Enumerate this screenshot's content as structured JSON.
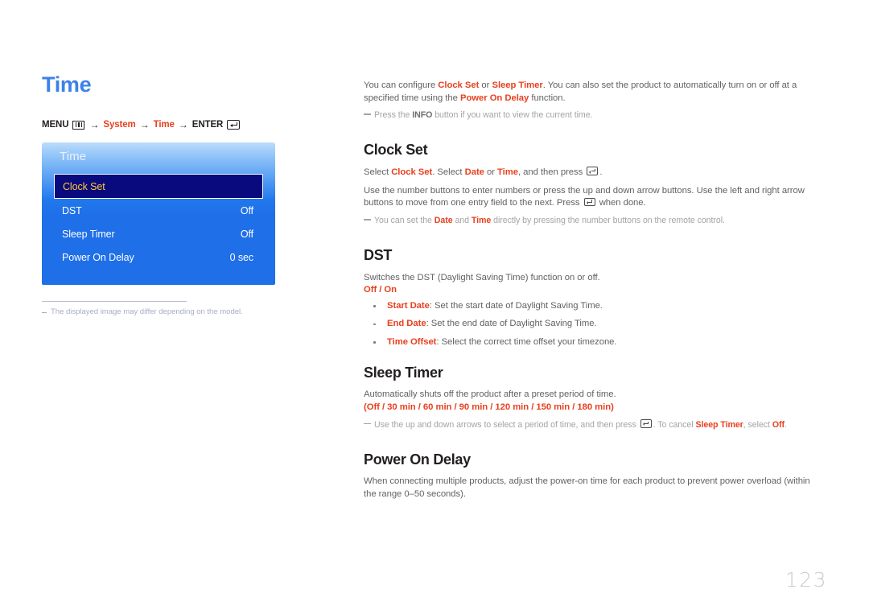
{
  "page": {
    "title": "Time",
    "number": "123"
  },
  "breadcrumb": {
    "menu_label": "MENU",
    "menu_icon": "menu-grid-icon",
    "arrow": "→",
    "item1": "System",
    "item2": "Time",
    "enter_label": "ENTER",
    "enter_icon": "enter-key-icon"
  },
  "osd": {
    "title": "Time",
    "rows": [
      {
        "label": "Clock Set",
        "value": "",
        "selected": true
      },
      {
        "label": "DST",
        "value": "Off",
        "selected": false
      },
      {
        "label": "Sleep Timer",
        "value": "Off",
        "selected": false
      },
      {
        "label": "Power On Delay",
        "value": "0 sec",
        "selected": false
      }
    ]
  },
  "image_note": "The displayed image may differ depending on the model.",
  "intro": {
    "p1_a": "You can configure ",
    "p1_b1": "Clock Set",
    "p1_c": " or ",
    "p1_b2": "Sleep Timer",
    "p1_d": ". You can also set the product to automatically turn on or off at a specified time using the ",
    "p1_b3": "Power On Delay",
    "p1_e": " function.",
    "note_a": "Press the ",
    "note_b": "INFO",
    "note_c": " button if you want to view the current time."
  },
  "clock_set": {
    "heading": "Clock Set",
    "p1_a": "Select ",
    "p1_b1": "Clock Set",
    "p1_c": ". Select ",
    "p1_b2": "Date",
    "p1_d": " or ",
    "p1_b3": "Time",
    "p1_e": ", and then press ",
    "p1_f": ".",
    "p2_a": "Use the number buttons to enter numbers or press the up and down arrow buttons. Use the left and right arrow buttons to move from one entry field to the next. Press ",
    "p2_b": " when done.",
    "note_a": "You can set the ",
    "note_b1": "Date",
    "note_c": " and ",
    "note_b2": "Time",
    "note_d": " directly by pressing the number buttons on the remote control."
  },
  "dst": {
    "heading": "DST",
    "p1": "Switches the DST (Daylight Saving Time) function on or off.",
    "options": "Off / On",
    "bullets": [
      {
        "term": "Start Date",
        "desc": ": Set the start date of Daylight Saving Time."
      },
      {
        "term": "End Date",
        "desc": ": Set the end date of Daylight Saving Time."
      },
      {
        "term": "Time Offset",
        "desc": ": Select the correct time offset your timezone."
      }
    ]
  },
  "sleep_timer": {
    "heading": "Sleep Timer",
    "p1": "Automatically shuts off the product after a preset period of time.",
    "options": "(Off / 30 min / 60 min / 90 min / 120 min / 150 min / 180 min)",
    "note_a": "Use the up and down arrows to select a period of time, and then press ",
    "note_b": ". To cancel ",
    "note_c": "Sleep Timer",
    "note_d": ", select ",
    "note_e": "Off",
    "note_f": "."
  },
  "power_on_delay": {
    "heading": "Power On Delay",
    "p1": "When connecting multiple products, adjust the power-on time for each product to prevent power overload (within the range 0–50 seconds)."
  },
  "colors": {
    "accent_red": "#e8401f",
    "title_blue": "#3b82e8",
    "osd_blue": "#1f6fe8",
    "osd_selected": "#0a0a7f",
    "osd_selected_text": "#ffcc33"
  }
}
